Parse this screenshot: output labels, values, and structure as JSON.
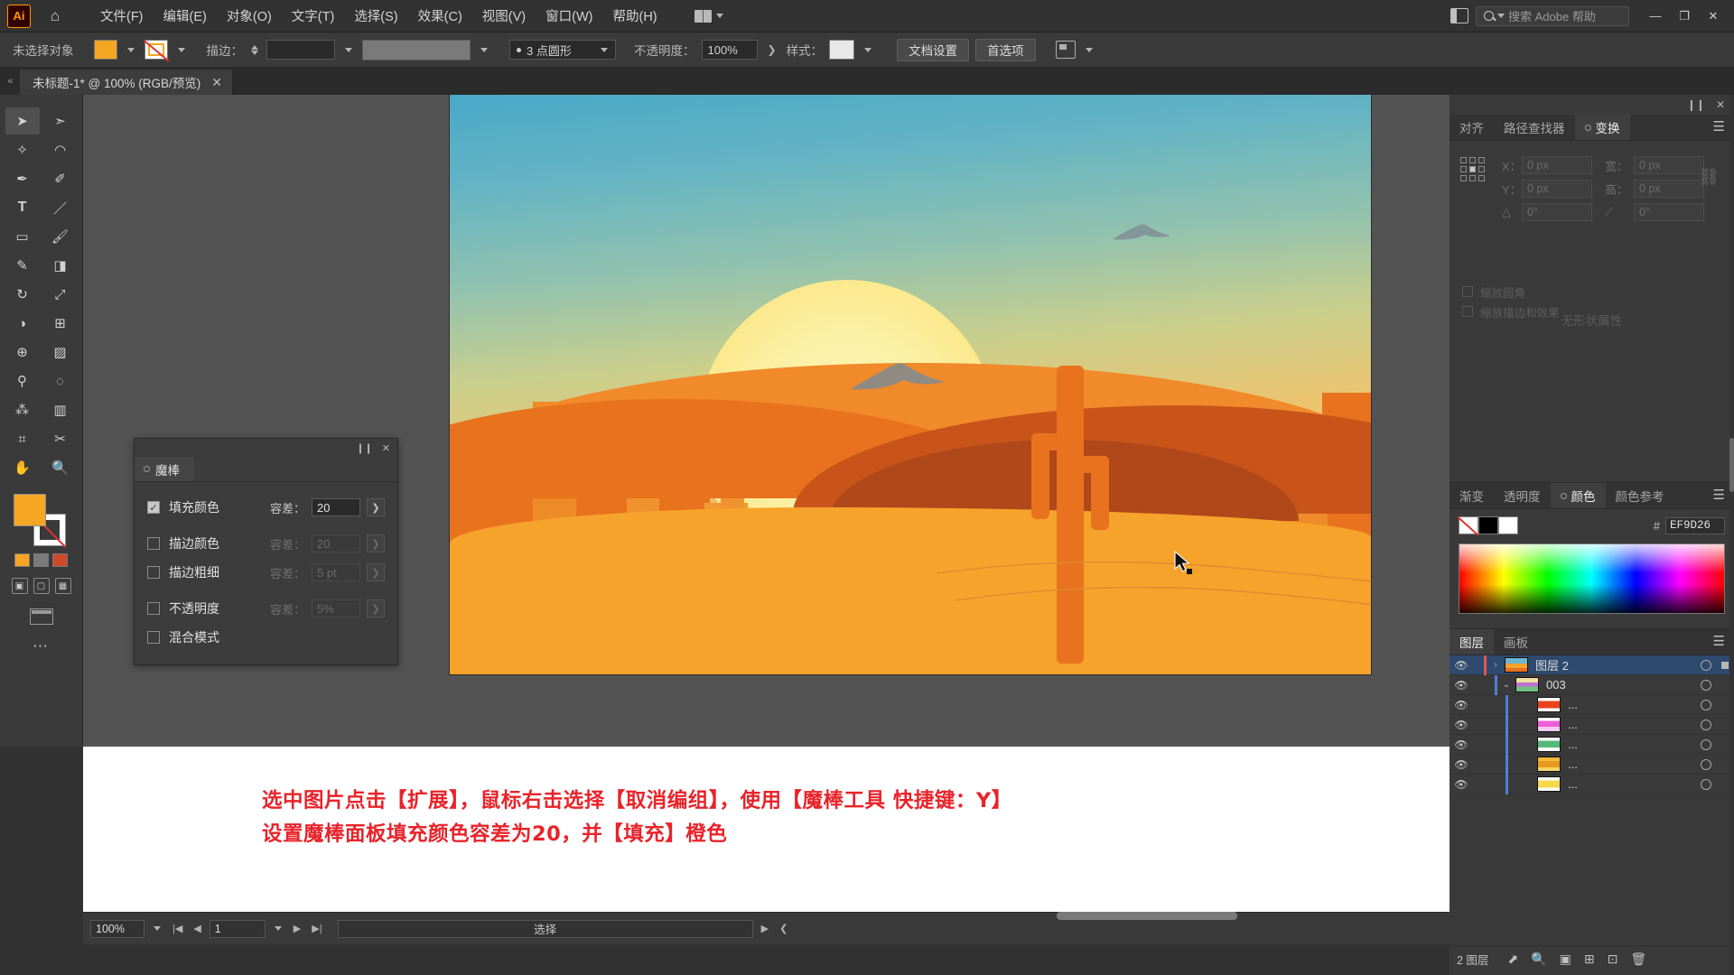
{
  "app": {
    "name": "Adobe Illustrator",
    "logo_text": "Ai"
  },
  "menubar": {
    "home_icon": "home-icon",
    "items": [
      {
        "label": "文件(F)"
      },
      {
        "label": "编辑(E)"
      },
      {
        "label": "对象(O)"
      },
      {
        "label": "文字(T)"
      },
      {
        "label": "选择(S)"
      },
      {
        "label": "效果(C)"
      },
      {
        "label": "视图(V)"
      },
      {
        "label": "窗口(W)"
      },
      {
        "label": "帮助(H)"
      }
    ],
    "search_placeholder": "搜索 Adobe 帮助",
    "minimize": "—",
    "maximize": "❐",
    "close": "✕"
  },
  "controlbar": {
    "selection_status": "未选择对象",
    "stroke_label": "描边：",
    "stroke_width": "",
    "brush_preset": "3 点圆形",
    "opacity_label": "不透明度：",
    "opacity_value": "100%",
    "style_label": "样式：",
    "doc_setup": "文档设置",
    "preferences": "首选项"
  },
  "document_tab": {
    "title": "未标题-1* @ 100% (RGB/预览)",
    "close": "✕"
  },
  "toolbar": {
    "tools": [
      {
        "name": "selection-tool",
        "glyph": "➤",
        "selected": true
      },
      {
        "name": "direct-selection-tool",
        "glyph": "➣",
        "selected": false
      },
      {
        "name": "magic-wand-tool",
        "glyph": "✧",
        "selected": false
      },
      {
        "name": "lasso-tool",
        "glyph": "◠",
        "selected": false
      },
      {
        "name": "pen-tool",
        "glyph": "✒",
        "selected": false
      },
      {
        "name": "curvature-tool",
        "glyph": "✐",
        "selected": false
      },
      {
        "name": "type-tool",
        "glyph": "T",
        "selected": false
      },
      {
        "name": "line-segment-tool",
        "glyph": "／",
        "selected": false
      },
      {
        "name": "rectangle-tool",
        "glyph": "▭",
        "selected": false
      },
      {
        "name": "paintbrush-tool",
        "glyph": "🖌",
        "selected": false
      },
      {
        "name": "shaper-tool",
        "glyph": "✎",
        "selected": false
      },
      {
        "name": "eraser-tool",
        "glyph": "◨",
        "selected": false
      },
      {
        "name": "rotate-tool",
        "glyph": "↻",
        "selected": false
      },
      {
        "name": "scale-tool",
        "glyph": "⤢",
        "selected": false
      },
      {
        "name": "width-tool",
        "glyph": "◑",
        "selected": false
      },
      {
        "name": "free-transform-tool",
        "glyph": "⊞",
        "selected": false
      },
      {
        "name": "shape-builder-tool",
        "glyph": "⊕",
        "selected": false
      },
      {
        "name": "gradient-tool",
        "glyph": "▨",
        "selected": false
      },
      {
        "name": "eyedropper-tool",
        "glyph": "⚲",
        "selected": false
      },
      {
        "name": "blend-tool",
        "glyph": "◌",
        "selected": false
      },
      {
        "name": "symbol-sprayer-tool",
        "glyph": "⁂",
        "selected": false
      },
      {
        "name": "column-graph-tool",
        "glyph": "▥",
        "selected": false
      },
      {
        "name": "artboard-tool",
        "glyph": "⌗",
        "selected": false
      },
      {
        "name": "slice-tool",
        "glyph": "✂",
        "selected": false
      },
      {
        "name": "hand-tool",
        "glyph": "✋",
        "selected": false
      },
      {
        "name": "zoom-tool",
        "glyph": "🔍",
        "selected": false
      }
    ],
    "fill_color": "#f5a623",
    "stroke_color": "#ffffff",
    "more_tools": "⋯"
  },
  "magic_wand_panel": {
    "tab_label": "魔棒",
    "collapse_icon": "collapse-icon",
    "close_icon": "✕",
    "rows": [
      {
        "label": "填充颜色",
        "checked": true,
        "tolerance_label": "容差：",
        "tolerance_value": "20",
        "enabled": true
      },
      {
        "label": "描边颜色",
        "checked": false,
        "tolerance_label": "容差：",
        "tolerance_value": "20",
        "enabled": false
      },
      {
        "label": "描边粗细",
        "checked": false,
        "tolerance_label": "容差：",
        "tolerance_value": "5 pt",
        "enabled": false
      },
      {
        "label": "不透明度",
        "checked": false,
        "tolerance_label": "容差：",
        "tolerance_value": "5%",
        "enabled": false
      },
      {
        "label": "混合模式",
        "checked": false,
        "tolerance_label": "",
        "tolerance_value": "",
        "enabled": false
      }
    ]
  },
  "transform_panel": {
    "tabs": [
      {
        "label": "对齐",
        "active": false
      },
      {
        "label": "路径查找器",
        "active": false
      },
      {
        "label": "变换",
        "active": true
      }
    ],
    "fields": [
      {
        "label": "X：",
        "value": "0 px"
      },
      {
        "label": "宽：",
        "value": "0 px"
      },
      {
        "label": "Y：",
        "value": "0 px"
      },
      {
        "label": "高：",
        "value": "0 px"
      }
    ],
    "angle_value": "0°",
    "shear_value": "0°",
    "empty_text": "无形状属性",
    "checks": [
      {
        "label": "缩放圆角"
      },
      {
        "label": "缩放描边和效果"
      }
    ],
    "menu_icon": "☰"
  },
  "color_panel": {
    "tabs": [
      {
        "label": "渐变",
        "active": false
      },
      {
        "label": "透明度",
        "active": false
      },
      {
        "label": "颜色",
        "active": true
      },
      {
        "label": "颜色参考",
        "active": false
      }
    ],
    "hex_hash": "#",
    "hex_value": "EF9D26",
    "menu_icon": "☰"
  },
  "layers_panel": {
    "tabs": [
      {
        "label": "图层",
        "active": true
      },
      {
        "label": "画板",
        "active": false
      }
    ],
    "menu_icon": "☰",
    "rows": [
      {
        "name": "图层 2",
        "indent": 0,
        "selected": true,
        "expand": "›",
        "thumb_colors": [
          "#4aa8c8",
          "#f5a32a",
          "#e8721e"
        ],
        "visible": true
      },
      {
        "name": "003",
        "indent": 1,
        "selected": false,
        "expand": "⌄",
        "thumb_colors": [
          "#f0e0a0",
          "#c070d0",
          "#70c080"
        ],
        "visible": true
      },
      {
        "name": "...",
        "indent": 2,
        "selected": false,
        "expand": "",
        "thumb_colors": [
          "#ffffff",
          "#e8431c",
          "#ffffff"
        ],
        "visible": true
      },
      {
        "name": "...",
        "indent": 2,
        "selected": false,
        "expand": "",
        "thumb_colors": [
          "#ffffff",
          "#ec5fd8",
          "#f3c8f3"
        ],
        "visible": true
      },
      {
        "name": "...",
        "indent": 2,
        "selected": false,
        "expand": "",
        "thumb_colors": [
          "#ffffff",
          "#55b97a",
          "#ffffff"
        ],
        "visible": true
      },
      {
        "name": "...",
        "indent": 2,
        "selected": false,
        "expand": "",
        "thumb_colors": [
          "#f6b93a",
          "#e89a1e",
          "#f6d36a"
        ],
        "visible": true
      },
      {
        "name": "...",
        "indent": 2,
        "selected": false,
        "expand": "",
        "thumb_colors": [
          "#ffffff",
          "#f7d84a",
          "#ffffff"
        ],
        "visible": true
      }
    ],
    "footer_count": "2 图层",
    "footer_icons": [
      "clip-mask-icon",
      "locate-object-icon",
      "new-sublayer-icon",
      "new-layer-icon",
      "add-layer-icon",
      "delete-layer-icon"
    ]
  },
  "annotation": {
    "line1": "选中图片点击【扩展】，鼠标右击选择【取消编组】，使用【魔棒工具 快捷键：Y】",
    "line2": "设置魔棒面板填充颜色容差为20，并【填充】橙色",
    "color": "#e8232a"
  },
  "statusbar": {
    "zoom": "100%",
    "page": "1",
    "status_text": "选择",
    "first_icon": "|◀",
    "prev_icon": "◀",
    "next_icon": "▶",
    "last_icon": "▶|"
  },
  "artwork": {
    "title": "desert-sunset-illustration",
    "sky_colors": [
      "#4aa8c8",
      "#92c2ae",
      "#ecc46f",
      "#f09240"
    ],
    "sun_color": "#fdf6b8",
    "sand_color": "#f5a32a",
    "mesa_color": "#e8721e",
    "shadow_color": "#c9541a"
  }
}
